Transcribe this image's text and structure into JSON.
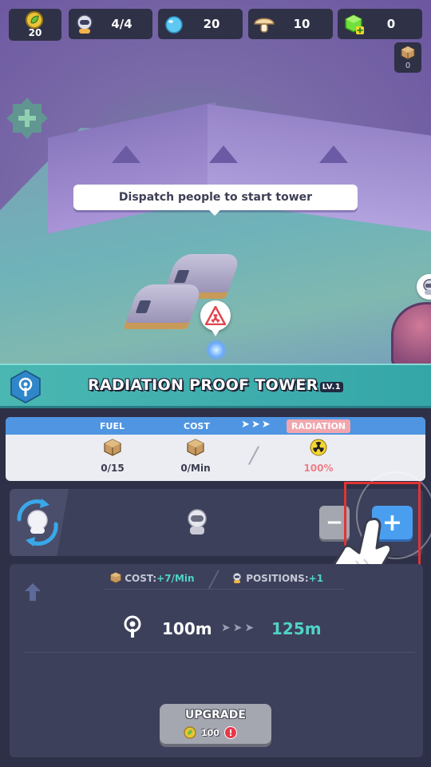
{
  "resources": {
    "leaf": "20",
    "people": "4/4",
    "water": "20",
    "food": "10",
    "gems": "0",
    "crates": "0"
  },
  "scene": {
    "tooltip": "Dispatch people to start tower"
  },
  "panel": {
    "title": "RADIATION PROOF TOWER",
    "level": "LV.1",
    "stats": {
      "fuel_label": "FUEL",
      "cost_label": "COST",
      "radiation_label": "RADIATION",
      "fuel_value": "0/15",
      "cost_value": "0/Min",
      "radiation_value": "100%"
    },
    "assign": {
      "minus": "−",
      "plus": "+"
    },
    "upgrade": {
      "cost_label": "COST:",
      "cost_value": "+7/Min",
      "positions_label": "POSITIONS:",
      "positions_value": "+1",
      "range_current": "100m",
      "range_next": "125m",
      "button_label": "UPGRADE",
      "button_cost": "100",
      "alert": "!"
    }
  },
  "colors": {
    "header": "#3aaaa9",
    "stats_bar": "#4f95e2",
    "radiation_red": "#ee7f88",
    "accent_green": "#4fd3c6",
    "plus_button": "#4a9ef0",
    "highlight": "#e03434"
  }
}
